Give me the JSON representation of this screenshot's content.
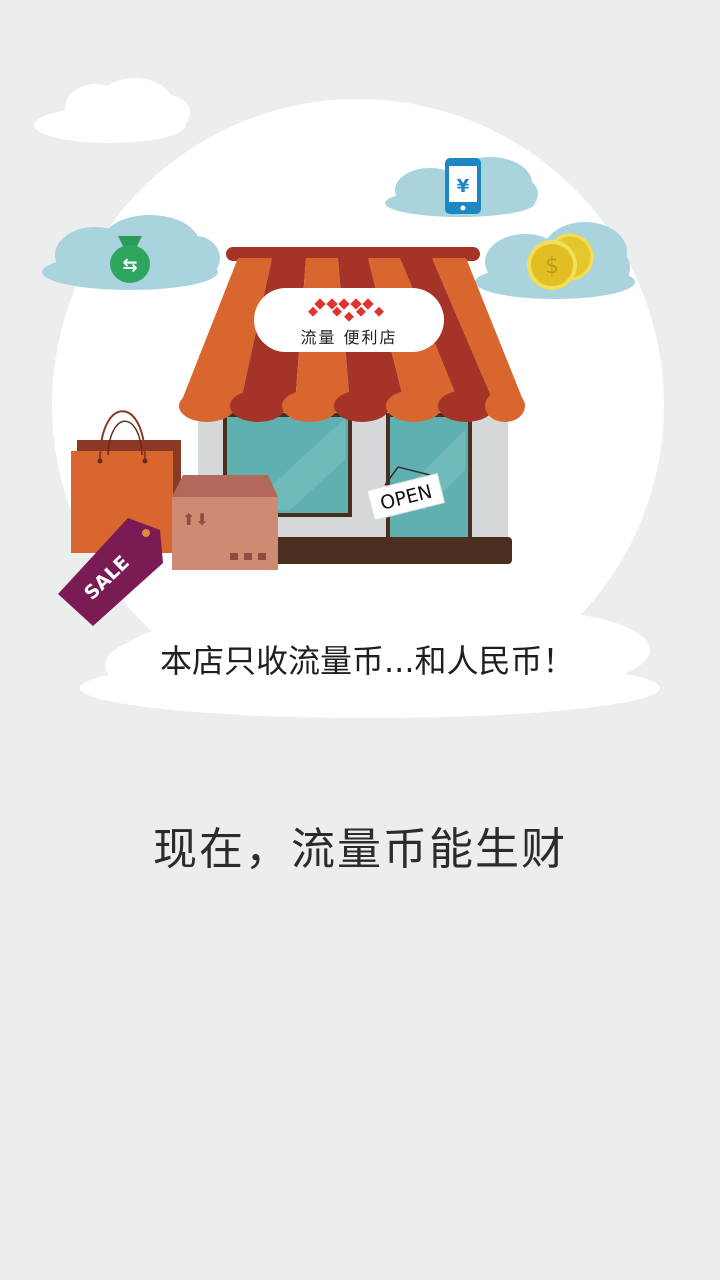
{
  "illustration": {
    "store_sign_text": "流量 便利店",
    "open_sign_text": "OPEN",
    "sale_tag_text": "SALE",
    "phone_symbol": "¥",
    "money_bag_symbol": "⇆",
    "coin_symbol": "$",
    "icons": [
      "money-bag-icon",
      "mobile-yen-icon",
      "gold-coins-icon",
      "shopping-bag-icon",
      "parcel-box-icon",
      "sale-tag-icon"
    ],
    "colors": {
      "background": "#ECEDED",
      "awning_orange": "#D9662E",
      "awning_red": "#A63327",
      "window_teal": "#5FB0B0",
      "cloud_blue": "#A9D3DD",
      "sale_tag": "#7A1B55",
      "coin_gold": "#E4C72C"
    }
  },
  "slogan": "本店只收流量币...和人民币！",
  "tagline": "现在，流量币能生财"
}
